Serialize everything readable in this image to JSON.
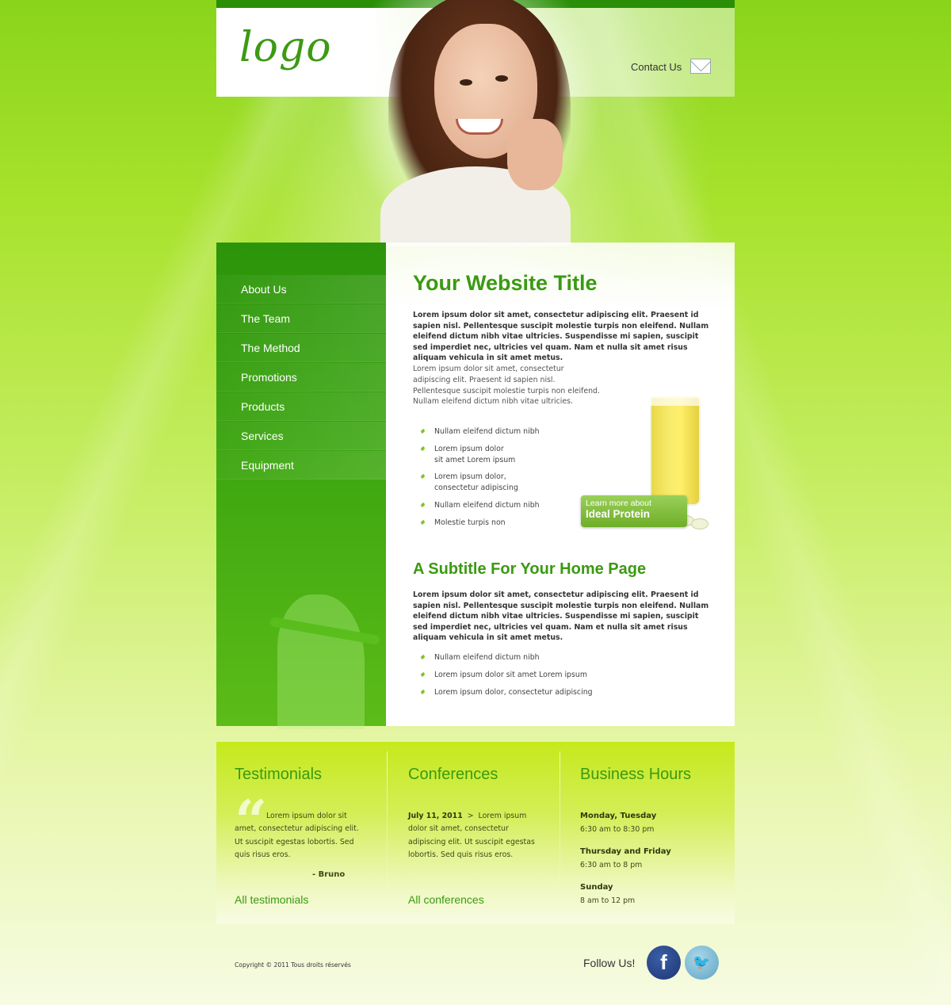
{
  "header": {
    "logo": "logo",
    "contact_label": "Contact Us"
  },
  "nav": [
    {
      "label": "About Us"
    },
    {
      "label": "The Team"
    },
    {
      "label": "The Method"
    },
    {
      "label": "Promotions"
    },
    {
      "label": "Products"
    },
    {
      "label": "Services"
    },
    {
      "label": "Equipment"
    }
  ],
  "main": {
    "title": "Your Website Title",
    "intro_bold": "Lorem ipsum dolor sit amet, consectetur adipiscing elit. Praesent id sapien nisl. Pellentesque suscipit molestie turpis non eleifend. Nullam eleifend dictum nibh vitae ultricies. Suspendisse mi sapien, suscipit sed imperdiet nec, ultricies vel quam. Nam et nulla sit amet risus aliquam vehicula in sit amet metus.",
    "intro_para": "Lorem ipsum dolor sit amet, consectetur adipiscing elit. Praesent id sapien nisl. Pellentesque suscipit molestie turpis non eleifend. Nullam eleifend dictum nibh vitae ultricies.",
    "list1": [
      "Nullam eleifend dictum nibh",
      "Lorem ipsum dolor\nsit amet Lorem ipsum",
      "Lorem ipsum dolor,\nconsectetur adipiscing",
      "Nullam eleifend dictum nibh",
      "Molestie turpis non"
    ],
    "promo_line1": "Learn more about",
    "promo_line2": "Ideal Protein",
    "subtitle": "A Subtitle For Your Home Page",
    "sub_bold": "Lorem ipsum dolor sit amet, consectetur adipiscing elit. Praesent id sapien nisl. Pellentesque suscipit molestie turpis non eleifend. Nullam eleifend dictum nibh vitae ultricies. Suspendisse mi sapien, suscipit sed imperdiet nec, ultricies vel quam. Nam et nulla sit amet risus aliquam vehicula in sit amet metus.",
    "list2": [
      "Nullam eleifend dictum nibh",
      "Lorem ipsum dolor sit amet Lorem ipsum",
      "Lorem ipsum dolor, consectetur adipiscing"
    ]
  },
  "panels": {
    "testimonials": {
      "title": "Testimonials",
      "text": "Lorem ipsum dolor sit amet, consectetur adipiscing elit. Ut suscipit egestas lobortis. Sed quis risus eros.",
      "author": "- Bruno",
      "link": "All testimonials"
    },
    "conferences": {
      "title": "Conferences",
      "date": "July 11, 2011",
      "separator": ">",
      "text": "Lorem ipsum dolor sit amet, consectetur adipiscing elit. Ut suscipit egestas lobortis. Sed quis risus eros.",
      "link": "All conferences"
    },
    "hours": {
      "title": "Business Hours",
      "entries": [
        {
          "day": "Monday, Tuesday",
          "time": "6:30 am to 8:30 pm"
        },
        {
          "day": "Thursday and Friday",
          "time": "6:30 am to 8 pm"
        },
        {
          "day": "Sunday",
          "time": "8 am to 12 pm"
        }
      ]
    }
  },
  "footer": {
    "copyright": "Copyright © 2011 Tous droits réservés",
    "follow": "Follow Us!",
    "facebook_glyph": "f",
    "twitter_glyph": "🐦"
  },
  "colors": {
    "brand_green": "#3a9a12",
    "nav_green": "#2c940a",
    "facebook": "#1d3672",
    "twitter": "#5fa4c4"
  },
  "icons": [
    "mail-icon",
    "quote-icon",
    "bullet-leaf-icon",
    "facebook-icon",
    "twitter-icon"
  ]
}
